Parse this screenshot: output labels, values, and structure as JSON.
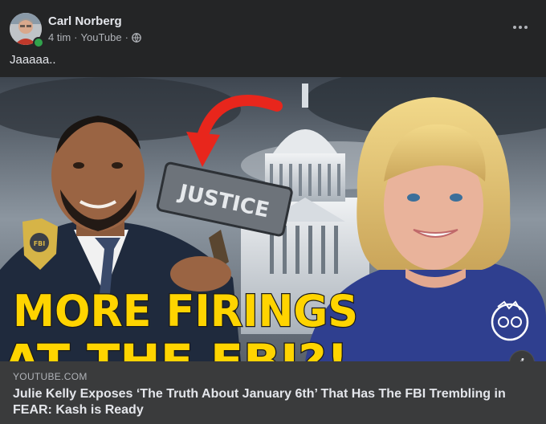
{
  "post": {
    "author": "Carl Norberg",
    "time": "4 tim",
    "source": "YouTube",
    "separator": "·",
    "caption": "Jaaaaa..",
    "privacy_icon": "globe-icon",
    "more_icon": "more-options-icon"
  },
  "thumbnail": {
    "headline_line1": "MORE FIRINGS",
    "headline_line2": "AT THE FBI?!",
    "hammer_text": "JUSTICE",
    "badge_text": "FBI"
  },
  "link_preview": {
    "domain": "YOUTUBE.COM",
    "title": "Julie Kelly Exposes ‘The Truth About January 6th’ That Has The FBI Trembling in FEAR: Kash is Ready",
    "info_icon": "info-icon",
    "info_glyph": "i"
  },
  "colors": {
    "background": "#242526",
    "text_primary": "#e4e6eb",
    "text_secondary": "#b0b3b8",
    "link_box": "#3a3b3c",
    "headline_yellow": "#ffd400",
    "arrow_red": "#e8261c",
    "online_green": "#31a24c"
  }
}
